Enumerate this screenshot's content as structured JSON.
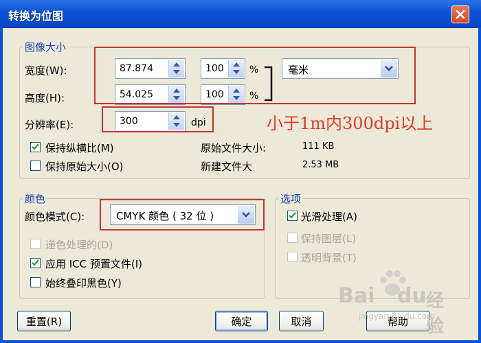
{
  "dialog": {
    "title": "转换为位图"
  },
  "image_size": {
    "group_label": "图像大小",
    "width_label": "宽度(W):",
    "height_label": "高度(H):",
    "resolution_label": "分辨率(E):",
    "width_value": "87.874",
    "height_value": "54.025",
    "width_percent": "100",
    "height_percent": "100",
    "percent_symbol": "%",
    "unit_value": "毫米",
    "resolution_value": "300",
    "resolution_unit": "dpi",
    "keep_ratio_label": "保持纵横比(M)",
    "keep_ratio_checked": true,
    "keep_original_label": "保持原始大小(O)",
    "keep_original_checked": false,
    "original_size_label": "原始文件大小:",
    "original_size_value": "111 KB",
    "new_size_label": "新建文件大",
    "new_size_value": "2.53 MB"
  },
  "color": {
    "group_label": "颜色",
    "mode_label": "颜色模式(C):",
    "mode_value": "CMYK 颜色 ( 32 位 )",
    "dither_label": "递色处理的(D)",
    "icc_label": "应用 ICC 预置文件(I)",
    "icc_checked": true,
    "overprint_label": "始终叠印黑色(Y)",
    "overprint_checked": false
  },
  "options": {
    "group_label": "选项",
    "smooth_label": "光滑处理(A)",
    "smooth_checked": true,
    "keep_layers_label": "保持图层(L)",
    "transparent_label": "透明背景(T)"
  },
  "buttons": {
    "reset": "重置(R)",
    "ok": "确定",
    "cancel": "取消",
    "help": "帮助"
  },
  "annotation": {
    "text": "小于1m内300dpi以上"
  },
  "watermark": {
    "brand_text": "Bai",
    "brand_text2": "du",
    "cn_text": "经验",
    "url": "jingyan.baidu.com"
  },
  "colors": {
    "title_bar": "#0a52d6",
    "annotation": "#e03a2a",
    "group_label": "#1a3fae"
  }
}
